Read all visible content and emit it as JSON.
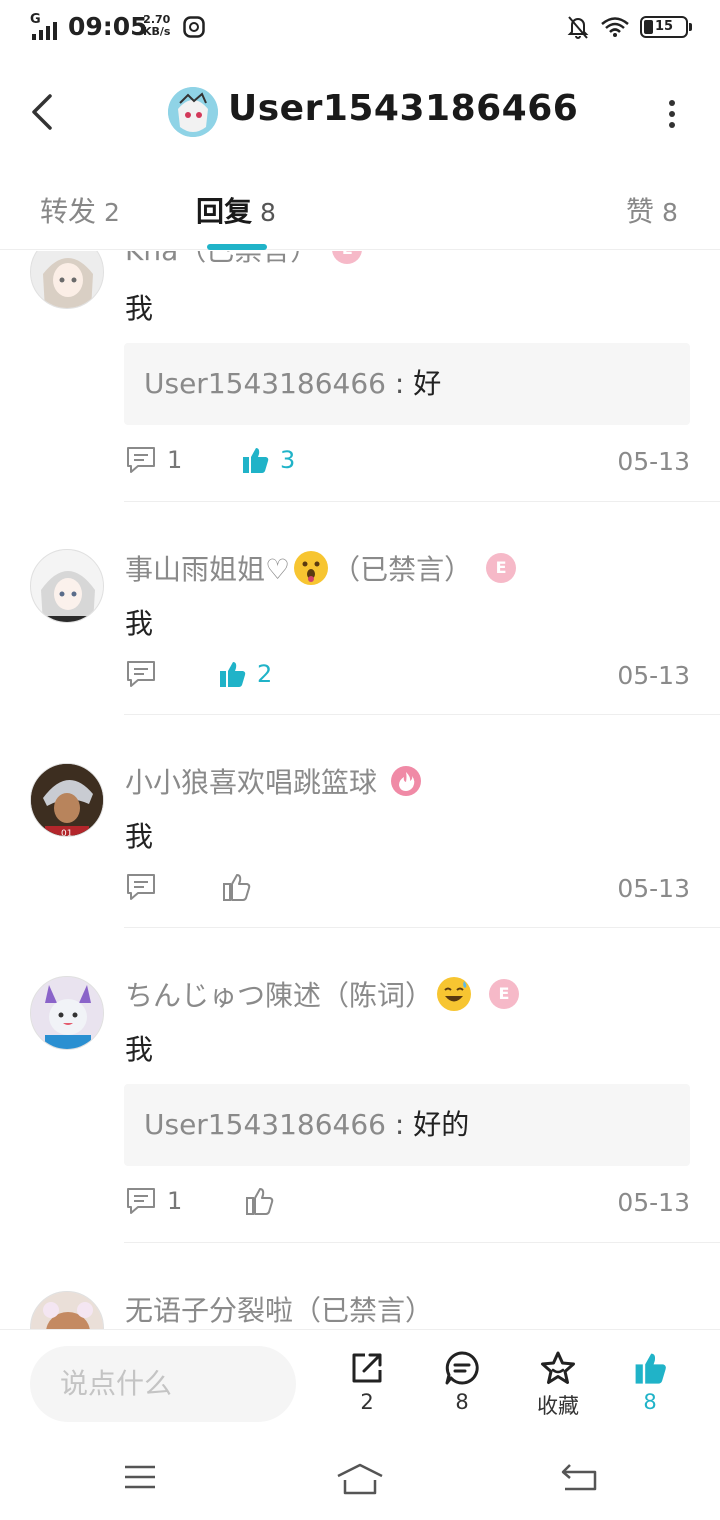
{
  "status": {
    "network": "G",
    "time": "09:05",
    "speed_value": "2.70",
    "speed_unit": "KB/s",
    "battery": "15"
  },
  "header": {
    "title": "User1543186466"
  },
  "tabs": [
    {
      "label": "转发",
      "count": "2"
    },
    {
      "label": "回复",
      "count": "8"
    },
    {
      "label": "赞",
      "count": "8"
    }
  ],
  "comments": [
    {
      "name": "Kna（已禁言）",
      "text": "我",
      "quote_user": "User1543186466",
      "quote_sep": " : ",
      "quote_text": "好",
      "reply_count": "1",
      "like_count": "3",
      "liked": true,
      "date": "05-13"
    },
    {
      "name": "事山雨姐姐♡",
      "suffix": "（已禁言）",
      "badge": "E",
      "text": "我",
      "reply_count": "",
      "like_count": "2",
      "liked": true,
      "date": "05-13"
    },
    {
      "name": "小小狼喜欢唱跳篮球",
      "text": "我",
      "reply_count": "",
      "like_count": "",
      "liked": false,
      "date": "05-13"
    },
    {
      "name": "ちんじゅつ陳述（陈词）",
      "badge": "E",
      "text": "我",
      "quote_user": "User1543186466",
      "quote_sep": " : ",
      "quote_text": "好的",
      "reply_count": "1",
      "like_count": "",
      "liked": false,
      "date": "05-13"
    },
    {
      "name": "无语子分裂啦（已禁言）"
    }
  ],
  "bottom": {
    "input_placeholder": "说点什么",
    "repost_count": "2",
    "comment_count": "8",
    "favorite_label": "收藏",
    "like_count": "8"
  },
  "colors": {
    "accent": "#20b3c8",
    "muted_text": "#8a8a8a",
    "badge_pink": "#f6b9c8"
  }
}
